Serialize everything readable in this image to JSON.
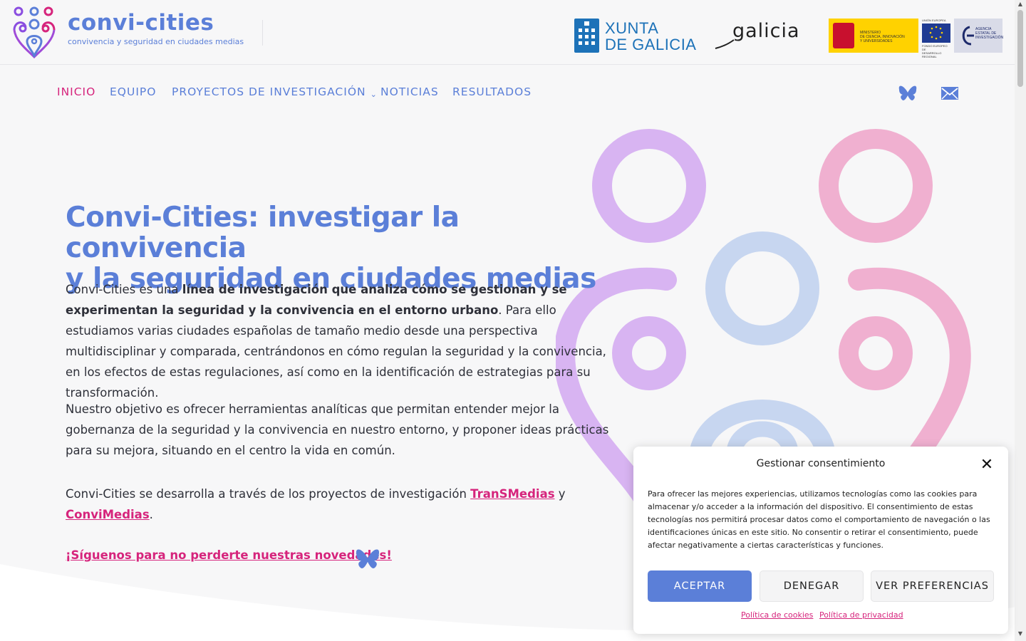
{
  "brand": {
    "name": "convi-cities",
    "tagline": "convivencia y seguridad en ciudades medias"
  },
  "partners": {
    "xunta_line1": "XUNTA",
    "xunta_line2": "DE GALICIA",
    "galicia": "galicia",
    "ministerio_l1": "MINISTERIO",
    "ministerio_l2": "DE CIENCIA, INNOVACIÓN",
    "ministerio_l3": "Y UNIVERSIDADES",
    "eu_top": "UNIÓN EUROPEA",
    "eu_bottom_l1": "FONDO EUROPEO DE",
    "eu_bottom_l2": "DESARROLLO REGIONAL",
    "aei_l1": "AGENCIA",
    "aei_l2": "ESTATAL DE",
    "aei_l3": "INVESTIGACIÓN"
  },
  "nav": {
    "items": [
      {
        "label": "INICIO"
      },
      {
        "label": "EQUIPO"
      },
      {
        "label": "PROYECTOS DE INVESTIGACIÓN"
      },
      {
        "label": "NOTICIAS"
      },
      {
        "label": "RESULTADOS"
      }
    ],
    "dropdown_glyph": "⌄",
    "social_icons": [
      "bluesky-icon",
      "mail-icon"
    ]
  },
  "hero": {
    "title_line1": "Convi-Cities: investigar la convivencia",
    "title_line2": "y la seguridad en ciudades medias",
    "p1_pre": "Convi-Cities es una ",
    "p1_bold": "línea de investigación que analiza cómo se gestionan y se experimentan la seguridad y la convivencia en el entorno urbano",
    "p1_post": ". Para ello estudiamos varias ciudades españolas de tamaño medio desde una perspectiva multidisciplinar y comparada, centrándonos en cómo regulan la seguridad y la convivencia, en los efectos de estas regulaciones, así como en la identificación de estrategias para su transformación.",
    "p2": "Nuestro objetivo es ofrecer herramientas analíticas que permitan entender mejor la gobernanza de la seguridad y la convivencia en nuestro entorno, y proponer ideas prácticas para su mejora, situando en el centro la vida en común.",
    "p3_pre": "Convi-Cities se desarrolla a través de los proyectos de investigación ",
    "p3_link1": "TranSMedias",
    "p3_mid": " y",
    "p3_link2": "ConviMedias",
    "p3_post": ".",
    "follow": "¡Síguenos para no perderte nuestras novedades!"
  },
  "consent": {
    "title": "Gestionar consentimiento",
    "close": "✕",
    "body": "Para ofrecer las mejores experiencias, utilizamos tecnologías como las cookies para almacenar y/o acceder a la información del dispositivo. El consentimiento de estas tecnologías nos permitirá procesar datos como el comportamiento de navegación o las identificaciones únicas en este sitio. No consentir o retirar el consentimiento, puede afectar negativamente a ciertas características y funciones.",
    "accept": "ACEPTAR",
    "deny": "DENEGAR",
    "preferences": "VER PREFERENCIAS",
    "cookie_policy": "Política de cookies",
    "privacy_policy": "Política de privacidad"
  },
  "colors": {
    "brand_blue": "#5b7fd8",
    "accent_pink": "#d6247c",
    "deco_purple": "#d8b4f2",
    "deco_pink": "#f0b0d0",
    "deco_blue": "#c7d6f0"
  }
}
